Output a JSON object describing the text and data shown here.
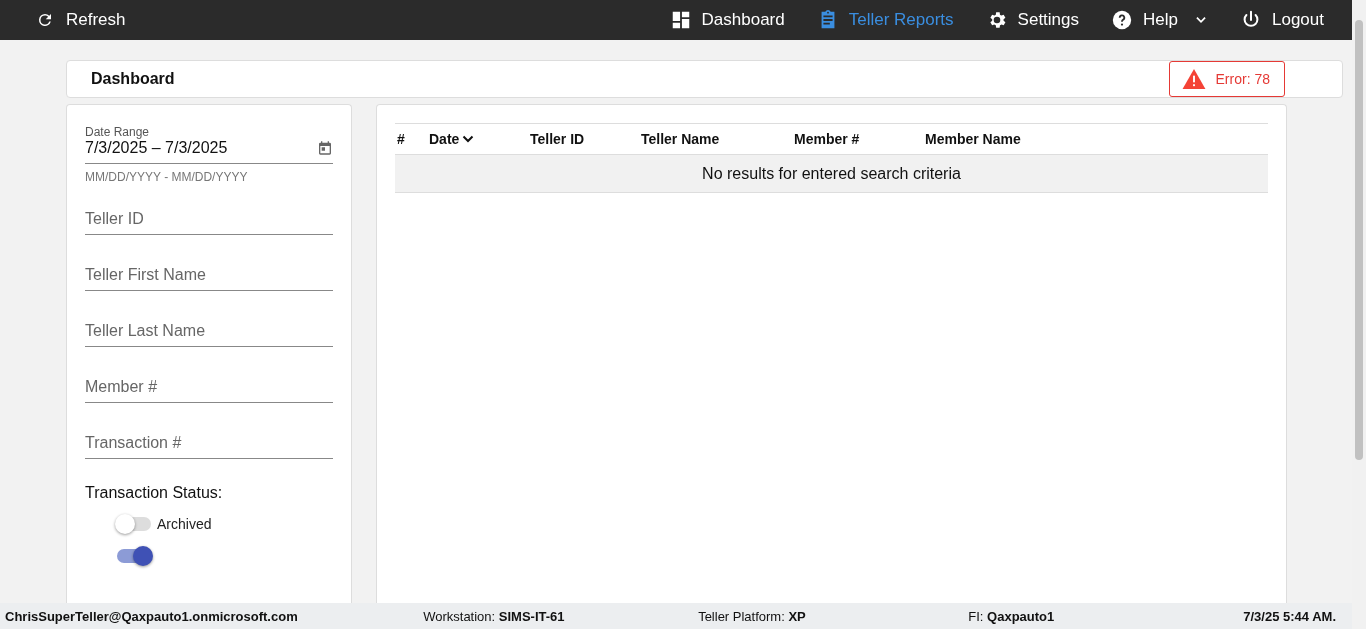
{
  "nav": {
    "refresh": "Refresh",
    "items": [
      {
        "label": "Dashboard",
        "kind": "dashboard",
        "selected": false
      },
      {
        "label": "Teller Reports",
        "kind": "clipboard",
        "selected": true
      },
      {
        "label": "Settings",
        "kind": "gear",
        "selected": false
      },
      {
        "label": "Help",
        "kind": "help",
        "selected": false,
        "dropdown": true
      },
      {
        "label": "Logout",
        "kind": "power",
        "selected": false
      }
    ]
  },
  "header": {
    "title": "Dashboard",
    "error": "Error: 78"
  },
  "filters": {
    "date_range": {
      "label": "Date Range",
      "value": "7/3/2025 – 7/3/2025",
      "hint": "MM/DD/YYYY - MM/DD/YYYY"
    },
    "fields": [
      {
        "placeholder": "Teller ID"
      },
      {
        "placeholder": "Teller First Name"
      },
      {
        "placeholder": "Teller Last Name"
      },
      {
        "placeholder": "Member #"
      },
      {
        "placeholder": "Transaction #"
      }
    ],
    "status_label": "Transaction Status:",
    "toggles": [
      {
        "label": "Archived",
        "on": false
      },
      {
        "on": true
      }
    ]
  },
  "table": {
    "columns": [
      {
        "label": "#"
      },
      {
        "label": "Date",
        "sorted": true
      },
      {
        "label": "Teller ID"
      },
      {
        "label": "Teller Name"
      },
      {
        "label": "Member #"
      },
      {
        "label": "Member Name"
      }
    ],
    "empty": "No results for entered search criteria"
  },
  "status_bar": {
    "user": "ChrisSuperTeller@Qaxpauto1.onmicrosoft.com",
    "items": [
      {
        "label": "Workstation:",
        "value": "SIMS-IT-61"
      },
      {
        "label": "Teller Platform:",
        "value": "XP"
      },
      {
        "label": "FI:",
        "value": "Qaxpauto1"
      }
    ],
    "time": "7/3/25 5:44 AM."
  }
}
